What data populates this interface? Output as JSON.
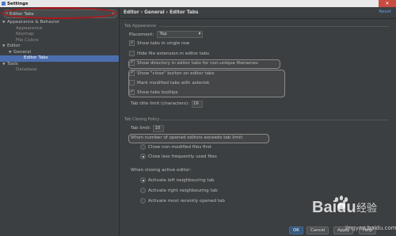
{
  "window": {
    "title": "Settings",
    "close": "✕"
  },
  "search": {
    "value": "Editor Tabs",
    "icon": "search-icon"
  },
  "tree": [
    {
      "label": "Appearance & Behavior",
      "level": 0,
      "arrow": "▼"
    },
    {
      "label": "Appearance",
      "level": 1
    },
    {
      "label": "Keymap",
      "level": 1
    },
    {
      "label": "File Colors",
      "level": 1
    },
    {
      "label": "Editor",
      "level": 0,
      "arrow": "▼"
    },
    {
      "label": "General",
      "level": 1,
      "arrow": "▼"
    },
    {
      "label": "Editor Tabs",
      "level": 2,
      "selected": true
    },
    {
      "label": "Tools",
      "level": 0,
      "arrow": "▼"
    },
    {
      "label": "Database",
      "level": 1
    }
  ],
  "breadcrumb": "Editor › General › Editor Tabs",
  "reset": "Reset",
  "tab_appearance": {
    "section": "Tab Appearance",
    "placement_label": "Placement:",
    "placement_value": "Top",
    "show_single_row": "Show tabs in single row",
    "hide_extension": "Hide file extension in editor tabs",
    "show_directory": "Show directory in editor tabs for non-unique filenames",
    "show_close": "Show \"close\" button on editor tabs",
    "mark_modified": "Mark modified tabs with asterisk",
    "show_tooltips": "Show tabs tooltips",
    "title_limit_label": "Tab title limit (characters):",
    "title_limit_value": "16"
  },
  "tab_closing": {
    "section": "Tab Closing Policy",
    "tab_limit_label": "Tab limit:",
    "tab_limit_value": "10",
    "when_exceeds": "When number of opened editors exceeds tab limit:",
    "close_non_modified": "Close non-modified files first",
    "close_less_frequent": "Close less frequently used files",
    "when_closing": "When closing active editor:",
    "activate_left": "Activate left neighbouring tab",
    "activate_right": "Activate right neighbouring tab",
    "activate_recent": "Activate most recently opened tab"
  },
  "buttons": {
    "ok": "OK",
    "cancel": "Cancel",
    "apply": "Apply",
    "help": "Help"
  },
  "watermark": {
    "brand": "Baidu",
    "sub_label": "经验",
    "site": "jingyan.baidu.com"
  },
  "colors": {
    "selection": "#4b6eaf",
    "annotation": "#b0161a",
    "link": "#589df6"
  }
}
